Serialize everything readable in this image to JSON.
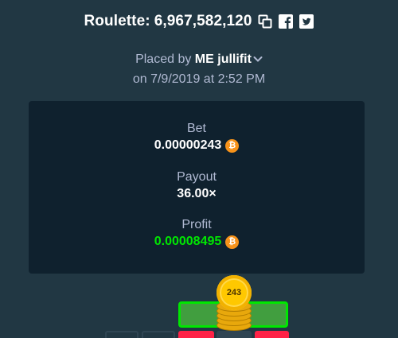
{
  "header": {
    "title": "Roulette:",
    "bet_id": "6,967,582,120",
    "icons": [
      "copy-icon",
      "facebook-icon",
      "twitter-icon"
    ]
  },
  "placed": {
    "prefix": "Placed by",
    "user": "ME jullifit",
    "date_line": "on 7/9/2019 at 2:52 PM"
  },
  "stats": {
    "bet_label": "Bet",
    "bet_value": "0.00000243",
    "payout_label": "Payout",
    "payout_value": "36.00×",
    "profit_label": "Profit",
    "profit_value": "0.00008495",
    "currency_symbol": "₿"
  },
  "chip": {
    "amount": "243"
  },
  "colors": {
    "background": "#213743",
    "card": "#0f212e",
    "profit_green": "#00e701",
    "bitcoin_orange": "#f7931a",
    "red_cell": "#fe2247",
    "chip_gold": "#ffc800"
  }
}
